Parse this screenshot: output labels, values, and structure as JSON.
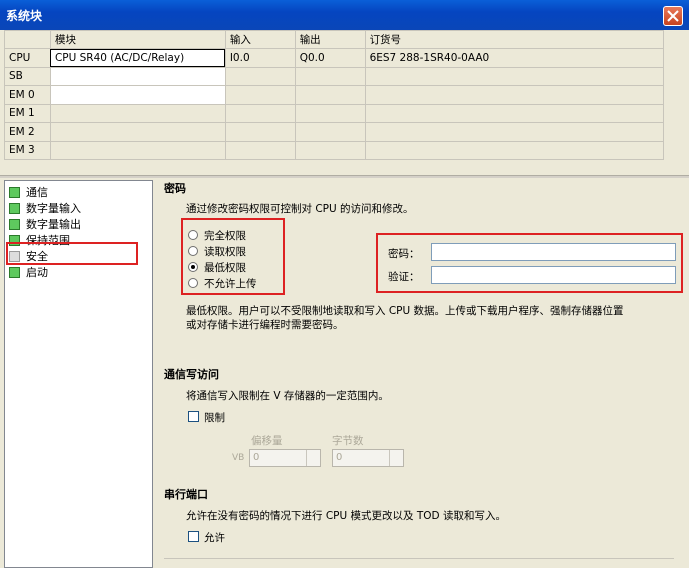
{
  "window": {
    "title": "系统块"
  },
  "grid": {
    "headers": [
      "",
      "模块",
      "输入",
      "输出",
      "订货号"
    ],
    "rows": [
      {
        "label": "CPU",
        "module": "CPU SR40 (AC/DC/Relay)",
        "input": "I0.0",
        "output": "Q0.0",
        "order": "6ES7 288-1SR40-0AA0"
      },
      {
        "label": "SB",
        "module": "",
        "input": "",
        "output": "",
        "order": ""
      },
      {
        "label": "EM 0",
        "module": "",
        "input": "",
        "output": "",
        "order": ""
      },
      {
        "label": "EM 1",
        "module": "",
        "input": "",
        "output": "",
        "order": ""
      },
      {
        "label": "EM 2",
        "module": "",
        "input": "",
        "output": "",
        "order": ""
      },
      {
        "label": "EM 3",
        "module": "",
        "input": "",
        "output": "",
        "order": ""
      }
    ]
  },
  "tree": {
    "items": [
      {
        "label": "通信"
      },
      {
        "label": "数字量输入"
      },
      {
        "label": "数字量输出"
      },
      {
        "label": "保持范围"
      },
      {
        "label": "安全"
      },
      {
        "label": "启动"
      }
    ]
  },
  "password": {
    "heading": "密码",
    "desc": "通过修改密码权限可控制对 CPU 的访问和修改。",
    "options": [
      "完全权限",
      "读取权限",
      "最低权限",
      "不允许上传"
    ],
    "selected": "最低权限",
    "pwd_label": "密码：",
    "verify_label": "验证：",
    "note_line1": "最低权限。用户可以不受限制地读取和写入 CPU 数据。上传或下载用户程序、强制存储器位置",
    "note_line2": "或对存储卡进行编程时需要密码。"
  },
  "comm_write": {
    "heading": "通信写访问",
    "desc": "将通信写入限制在 V 存储器的一定范围内。",
    "limit_label": "限制",
    "offset_label": "偏移量",
    "bytes_label": "字节数",
    "vb_prefix": "VB",
    "offset_value": "0",
    "bytes_value": "0"
  },
  "serial": {
    "heading": "串行端口",
    "desc": "允许在没有密码的情况下进行 CPU 模式更改以及 TOD 读取和写入。",
    "allow_label": "允许"
  },
  "colors": {
    "highlight_red": "#dd2222",
    "title_blue": "#0a46b8"
  }
}
